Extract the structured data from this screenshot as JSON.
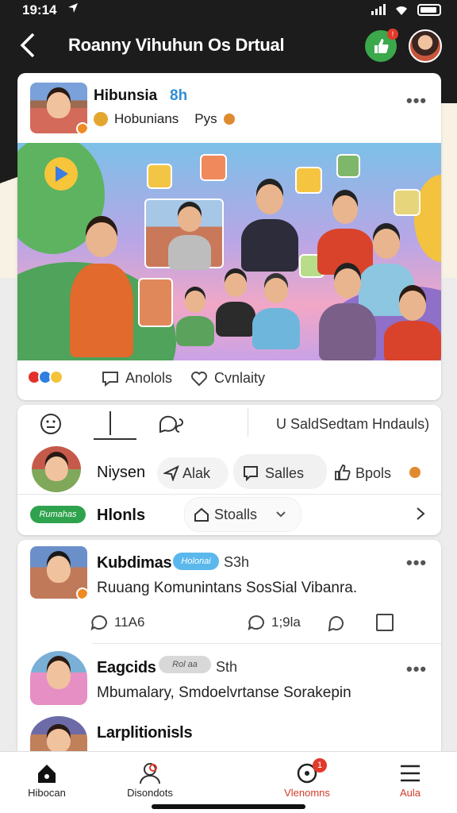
{
  "status": {
    "time": "19:14"
  },
  "header": {
    "title": "Roanny Vihuhun Os Drtual",
    "notification_count": "!"
  },
  "post1": {
    "author": "Hibunsia",
    "time": "8h",
    "subtitle": "Hobunians",
    "subtitle2": "Pys",
    "actions": {
      "comment": "Anolols",
      "like": "Cvnlaity"
    }
  },
  "composer": {
    "right_hint": "U SaldSedtam Hndauls)",
    "user_name": "Niysen",
    "chips": [
      "Alak",
      "Salles",
      "Bpols"
    ],
    "tag": "Rumahas",
    "row_label": "Hlonls",
    "dropdown": "Stoalls"
  },
  "feed": [
    {
      "author": "Kubdimas",
      "tag": "Holonai",
      "time": "S3h",
      "text": "Ruuang Komunintans SosSial Vibanra.",
      "comments": "11A6",
      "shares": "1;9la"
    },
    {
      "author": "Eagcids",
      "tag": "Rol aa",
      "time": "Sth",
      "text": "Mbumalary, Smdoelvrtanse Sorakepin"
    },
    {
      "author": "Larplitionisls"
    }
  ],
  "nav": [
    {
      "label": "Hibocan",
      "icon": "home-icon"
    },
    {
      "label": "Disondots",
      "icon": "people-icon"
    },
    {
      "label": "Vlenomns",
      "icon": "notification-icon",
      "badge": "1"
    },
    {
      "label": "Aula",
      "icon": "menu-icon"
    }
  ],
  "colors": {
    "accent_green": "#3ba84b",
    "accent_red": "#e23a2a",
    "link_blue": "#2f8fd6"
  }
}
